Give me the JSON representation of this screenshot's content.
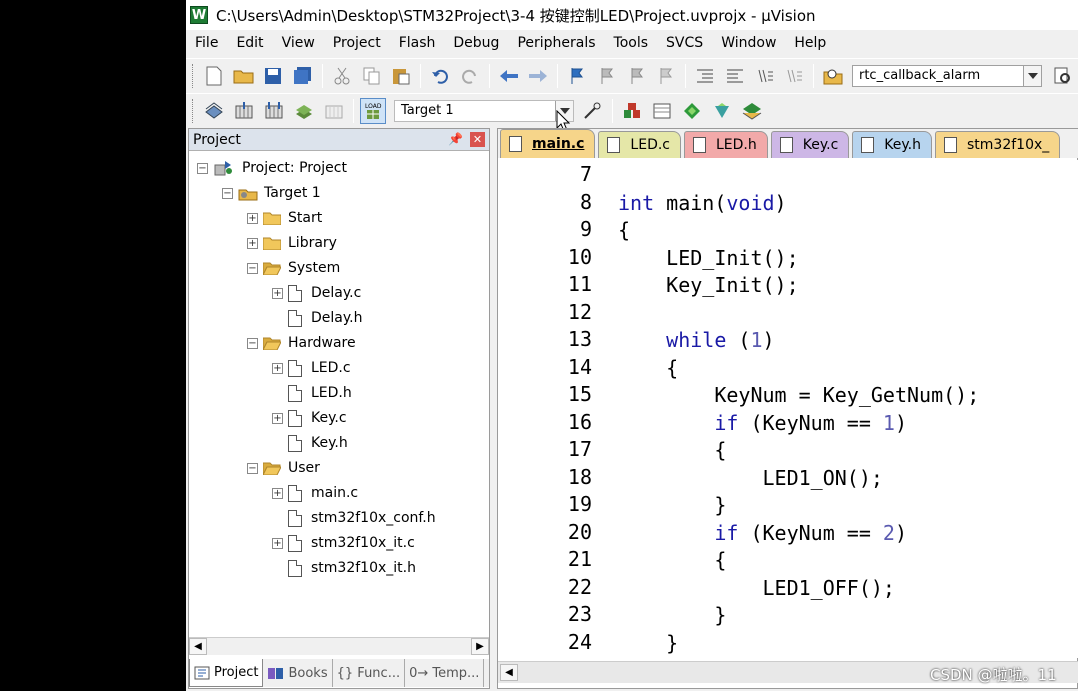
{
  "window": {
    "title": "C:\\Users\\Admin\\Desktop\\STM32Project\\3-4 按键控制LED\\Project.uvprojx - µVision",
    "app_icon": "W"
  },
  "menu": [
    "File",
    "Edit",
    "View",
    "Project",
    "Flash",
    "Debug",
    "Peripherals",
    "Tools",
    "SVCS",
    "Window",
    "Help"
  ],
  "toolbar1": {
    "find_combo": "rtc_callback_alarm"
  },
  "toolbar2": {
    "target_combo": "Target 1"
  },
  "project_pane": {
    "title": "Project",
    "pin": "ᵖ",
    "close": "✕",
    "tree": {
      "root": "Project: Project",
      "target": "Target 1",
      "groups": {
        "start": "Start",
        "library": "Library",
        "system": "System",
        "hardware": "Hardware",
        "user": "User"
      },
      "files": {
        "delay_c": "Delay.c",
        "delay_h": "Delay.h",
        "led_c": "LED.c",
        "led_h": "LED.h",
        "key_c": "Key.c",
        "key_h": "Key.h",
        "main_c": "main.c",
        "conf_h": "stm32f10x_conf.h",
        "it_c": "stm32f10x_it.c",
        "it_h": "stm32f10x_it.h"
      }
    },
    "bottom_tabs": [
      "Project",
      "Books",
      "{} Func...",
      "0→ Temp..."
    ]
  },
  "editor": {
    "tabs": [
      {
        "label": "main.c",
        "color": "#f6d58a",
        "active": true
      },
      {
        "label": "LED.c",
        "color": "#e5e7a8",
        "active": false
      },
      {
        "label": "LED.h",
        "color": "#f2a9a9",
        "active": false
      },
      {
        "label": "Key.c",
        "color": "#cdb7e6",
        "active": false
      },
      {
        "label": "Key.h",
        "color": "#b7d4ee",
        "active": false
      },
      {
        "label": "stm32f10x_",
        "color": "#f6d58a",
        "active": false
      }
    ],
    "line_numbers": [
      "7",
      "8",
      "9",
      "10",
      "11",
      "12",
      "13",
      "14",
      "15",
      "16",
      "17",
      "18",
      "19",
      "20",
      "21",
      "22",
      "23",
      "24"
    ],
    "code": [
      "",
      "int main(void)",
      "{",
      "    LED_Init();",
      "    Key_Init();",
      "",
      "    while (1)",
      "    {",
      "        KeyNum = Key_GetNum();",
      "        if (KeyNum == 1)",
      "        {",
      "            LED1_ON();",
      "        }",
      "        if (KeyNum == 2)",
      "        {",
      "            LED1_OFF();",
      "        }",
      "    }"
    ]
  },
  "watermark": "CSDN @啦啦。11",
  "icons": [
    "new-file-icon",
    "open-folder-icon",
    "save-icon",
    "save-all-icon",
    "cut-icon",
    "copy-icon",
    "paste-icon",
    "undo-icon",
    "redo-icon",
    "back-icon",
    "forward-icon",
    "bookmark-icon",
    "indent-icon",
    "outdent-icon",
    "comment-icon",
    "uncomment-icon",
    "find-in-files-icon",
    "translate-icon",
    "build-icon",
    "rebuild-icon",
    "batch-build-icon",
    "load-icon",
    "options-icon",
    "manage-icon",
    "pack-installer-icon"
  ]
}
